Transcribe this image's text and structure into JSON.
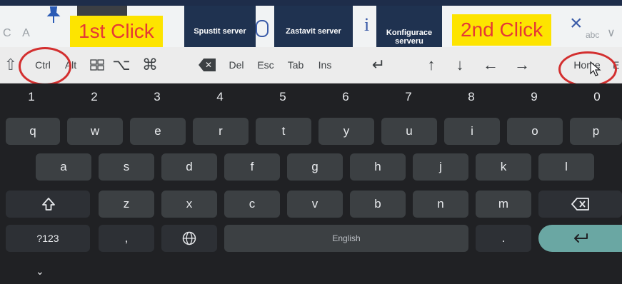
{
  "background_app": {
    "left_ghost_text": "C A",
    "buttons": [
      {
        "lines": [
          "Spustit server"
        ]
      },
      {
        "lines": [
          "Zastavit server"
        ]
      },
      {
        "lines": [
          "Konfigurace",
          "serveru"
        ]
      }
    ],
    "info_glyph": "i",
    "close_glyph": "×",
    "abc_text": "abc",
    "chevron_glyph": "∨"
  },
  "callouts": {
    "first": "1st Click",
    "second": "2nd Click"
  },
  "shortcut_row": {
    "ctrl": "Ctrl",
    "alt": "Alt",
    "option_glyph": "⌥",
    "command_glyph": "⌘",
    "del": "Del",
    "esc": "Esc",
    "tab": "Tab",
    "ins": "Ins",
    "return_glyph": "↵",
    "up": "↑",
    "down": "↓",
    "left": "←",
    "right": "→",
    "home": "Home",
    "end_partial": "E",
    "shift_glyph": "⇧"
  },
  "keyboard": {
    "digits": [
      "1",
      "2",
      "3",
      "4",
      "5",
      "6",
      "7",
      "8",
      "9",
      "0"
    ],
    "row_q": [
      "q",
      "w",
      "e",
      "r",
      "t",
      "y",
      "u",
      "i",
      "o",
      "p"
    ],
    "row_a": [
      "a",
      "s",
      "d",
      "f",
      "g",
      "h",
      "j",
      "k",
      "l"
    ],
    "row_z": [
      "z",
      "x",
      "c",
      "v",
      "b",
      "n",
      "m"
    ],
    "symbols_key": "?123",
    "comma": ",",
    "space_label": "English",
    "period": ".",
    "collapse_glyph": "⌄"
  },
  "colors": {
    "callout_bg": "#fde400",
    "callout_text": "#e53935",
    "circle": "#d32f2f",
    "key": "#3c4043",
    "enter_key": "#6aa7a3"
  }
}
